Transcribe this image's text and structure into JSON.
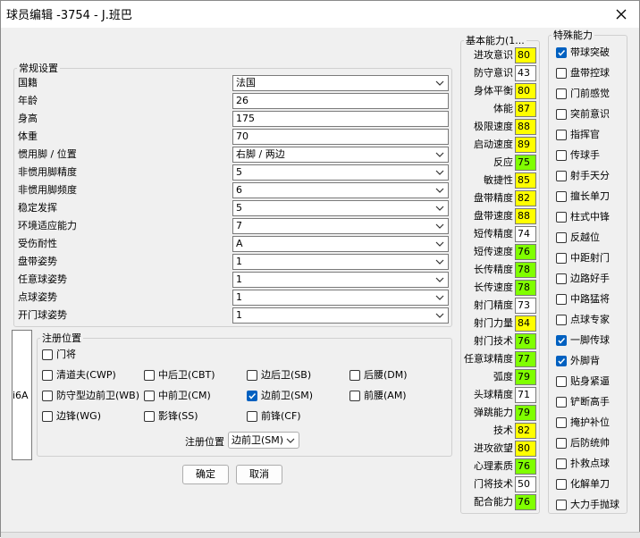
{
  "window": {
    "title": "球员编辑 -3754 - J.班巴"
  },
  "regular": {
    "title": "常规设置",
    "rows": [
      {
        "label": "国籍",
        "value": "法国",
        "combo": true
      },
      {
        "label": "年龄",
        "value": "26",
        "combo": false
      },
      {
        "label": "身高",
        "value": "175",
        "combo": false
      },
      {
        "label": "体重",
        "value": "70",
        "combo": false
      },
      {
        "label": "惯用脚 / 位置",
        "value": "右脚 / 两边",
        "combo": true
      },
      {
        "label": "非惯用脚精度",
        "value": "5",
        "combo": true
      },
      {
        "label": "非惯用脚频度",
        "value": "6",
        "combo": true
      },
      {
        "label": "稳定发挥",
        "value": "5",
        "combo": true
      },
      {
        "label": "环境适应能力",
        "value": "7",
        "combo": true
      },
      {
        "label": "受伤耐性",
        "value": "A",
        "combo": true
      },
      {
        "label": "盘带姿势",
        "value": "1",
        "combo": true
      },
      {
        "label": "任意球姿势",
        "value": "1",
        "combo": true
      },
      {
        "label": "点球姿势",
        "value": "1",
        "combo": true
      },
      {
        "label": "开门球姿势",
        "value": "1",
        "combo": true
      }
    ]
  },
  "left_panel": {
    "text": "i6A"
  },
  "positions": {
    "title": "注册位置",
    "gk": {
      "label": "门将",
      "checked": false
    },
    "items": [
      {
        "label": "清道夫(CWP)",
        "checked": false,
        "col": 0,
        "row": 0
      },
      {
        "label": "中后卫(CBT)",
        "checked": false,
        "col": 1,
        "row": 0
      },
      {
        "label": "边后卫(SB)",
        "checked": false,
        "col": 2,
        "row": 0
      },
      {
        "label": "后腰(DM)",
        "checked": false,
        "col": 3,
        "row": 0
      },
      {
        "label": "防守型边前卫(WB)",
        "checked": false,
        "col": 0,
        "row": 1
      },
      {
        "label": "中前卫(CM)",
        "checked": false,
        "col": 1,
        "row": 1
      },
      {
        "label": "边前卫(SM)",
        "checked": true,
        "col": 2,
        "row": 1
      },
      {
        "label": "前腰(AM)",
        "checked": false,
        "col": 3,
        "row": 1
      },
      {
        "label": "边锋(WG)",
        "checked": false,
        "col": 0,
        "row": 2
      },
      {
        "label": "影锋(SS)",
        "checked": false,
        "col": 1,
        "row": 2
      },
      {
        "label": "前锋(CF)",
        "checked": false,
        "col": 2,
        "row": 2
      }
    ],
    "registered_label": "注册位置",
    "registered_value": "边前卫(SM)"
  },
  "buttons": {
    "ok": "确定",
    "cancel": "取消"
  },
  "basic": {
    "title": "基本能力(1...",
    "stats": [
      {
        "label": "进攻意识",
        "value": "80",
        "color": "#ffff00"
      },
      {
        "label": "防守意识",
        "value": "43",
        "color": "#ffffff"
      },
      {
        "label": "身体平衡",
        "value": "80",
        "color": "#ffff00"
      },
      {
        "label": "体能",
        "value": "87",
        "color": "#ffff00"
      },
      {
        "label": "极限速度",
        "value": "88",
        "color": "#ffff00"
      },
      {
        "label": "启动速度",
        "value": "89",
        "color": "#ffff00"
      },
      {
        "label": "反应",
        "value": "75",
        "color": "#80ff00"
      },
      {
        "label": "敏捷性",
        "value": "85",
        "color": "#ffff00"
      },
      {
        "label": "盘带精度",
        "value": "82",
        "color": "#ffff00"
      },
      {
        "label": "盘带速度",
        "value": "88",
        "color": "#ffff00"
      },
      {
        "label": "短传精度",
        "value": "74",
        "color": "#ffffff"
      },
      {
        "label": "短传速度",
        "value": "76",
        "color": "#80ff00"
      },
      {
        "label": "长传精度",
        "value": "78",
        "color": "#80ff00"
      },
      {
        "label": "长传速度",
        "value": "78",
        "color": "#80ff00"
      },
      {
        "label": "射门精度",
        "value": "73",
        "color": "#ffffff"
      },
      {
        "label": "射门力量",
        "value": "84",
        "color": "#ffff00"
      },
      {
        "label": "射门技术",
        "value": "76",
        "color": "#80ff00"
      },
      {
        "label": "任意球精度",
        "value": "77",
        "color": "#80ff00"
      },
      {
        "label": "弧度",
        "value": "79",
        "color": "#80ff00"
      },
      {
        "label": "头球精度",
        "value": "71",
        "color": "#ffffff"
      },
      {
        "label": "弹跳能力",
        "value": "79",
        "color": "#80ff00"
      },
      {
        "label": "技术",
        "value": "82",
        "color": "#ffff00"
      },
      {
        "label": "进攻欲望",
        "value": "80",
        "color": "#ffff00"
      },
      {
        "label": "心理素质",
        "value": "76",
        "color": "#80ff00"
      },
      {
        "label": "门将技术",
        "value": "50",
        "color": "#ffffff"
      },
      {
        "label": "配合能力",
        "value": "76",
        "color": "#80ff00"
      }
    ]
  },
  "special": {
    "title": "特殊能力",
    "items": [
      {
        "label": "带球突破",
        "checked": true
      },
      {
        "label": "盘带控球",
        "checked": false
      },
      {
        "label": "门前感觉",
        "checked": false
      },
      {
        "label": "突前意识",
        "checked": false
      },
      {
        "label": "指挥官",
        "checked": false
      },
      {
        "label": "传球手",
        "checked": false
      },
      {
        "label": "射手天分",
        "checked": false
      },
      {
        "label": "擅长单刀",
        "checked": false
      },
      {
        "label": "柱式中锋",
        "checked": false
      },
      {
        "label": "反越位",
        "checked": false
      },
      {
        "label": "中距射门",
        "checked": false
      },
      {
        "label": "边路好手",
        "checked": false
      },
      {
        "label": "中路猛将",
        "checked": false
      },
      {
        "label": "点球专家",
        "checked": false
      },
      {
        "label": "一脚传球",
        "checked": true
      },
      {
        "label": "外脚背",
        "checked": true
      },
      {
        "label": "贴身紧逼",
        "checked": false
      },
      {
        "label": "铲断高手",
        "checked": false
      },
      {
        "label": "掩护补位",
        "checked": false
      },
      {
        "label": "后防统帅",
        "checked": false
      },
      {
        "label": "扑救点球",
        "checked": false
      },
      {
        "label": "化解单刀",
        "checked": false
      },
      {
        "label": "大力手抛球",
        "checked": false
      }
    ]
  }
}
